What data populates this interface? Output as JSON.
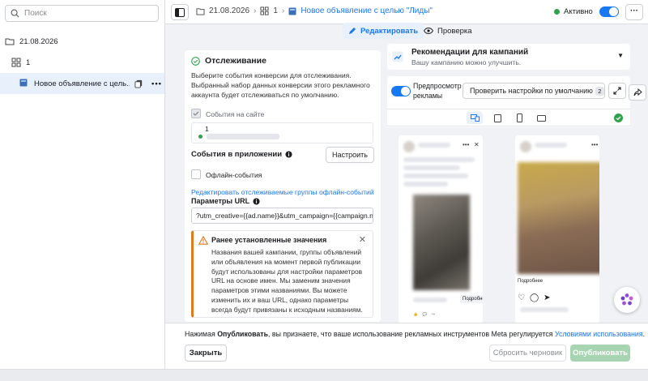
{
  "sidebar": {
    "search_placeholder": "Поиск",
    "campaign_label": "21.08.2026",
    "adset_label": "1",
    "ad_label": "Новое объявление с цель..."
  },
  "topbar": {
    "breadcrumb_campaign": "21.08.2026",
    "breadcrumb_adset": "1",
    "breadcrumb_ad": "Новое объявление с целью \"Лиды\"",
    "status_label": "Активно",
    "status_on": true
  },
  "tabs": {
    "edit": "Редактировать",
    "check": "Проверка"
  },
  "tracking": {
    "title": "Отслеживание",
    "description": "Выберите события конверсии для отслеживания. Выбранный набор данных конверсии этого рекламного аккаунта будет отслеживаться по умолчанию.",
    "site_events_label": "События на сайте",
    "dataset_id": "1",
    "app_events_title": "События в приложении",
    "setup_button": "Настроить",
    "offline_events_label": "Офлайн-события",
    "edit_offline_link": "Редактировать отслеживаемые группы офлайн-событий",
    "url_params_title": "Параметры URL",
    "url_params_value": "?utm_creative={{ad.name}}&utm_campaign={{campaign.n",
    "warning_title": "Ранее установленные значения",
    "warning_body": "Названия вашей кампании, группы объявлений или объявления на момент первой публикации будут использованы для настройки параметров URL на основе имен. Мы заменим значения параметров этими названиями. Вы можете изменить их и ваш URL, однако параметры всегда будут привязаны к исходным названиям."
  },
  "recommendations": {
    "title": "Рекомендации для кампаний",
    "subtitle": "Вашу кампанию можно улучшить."
  },
  "preview": {
    "toggle_label": "Предпросмотр рекламы",
    "check_defaults_button": "Проверить настройки по умолчанию",
    "check_defaults_count": "2",
    "fb_more_button": "Подробнее",
    "ig_more_text": "Подробнее"
  },
  "footer": {
    "notice_prefix": "Нажимая ",
    "notice_bold": "Опубликовать",
    "notice_middle": ", вы признаете, что ваше использование рекламных инструментов Meta регулируется ",
    "notice_link": "Условиями использования",
    "notice_suffix": ".",
    "close_button": "Закрыть",
    "discard_button": "Сбросить черновик",
    "publish_button": "Опубликовать"
  },
  "colors": {
    "accent": "#1877f2",
    "active_green": "#31a24c",
    "warning_orange": "#e07a1f",
    "publish_disabled": "#a8d5b1"
  }
}
